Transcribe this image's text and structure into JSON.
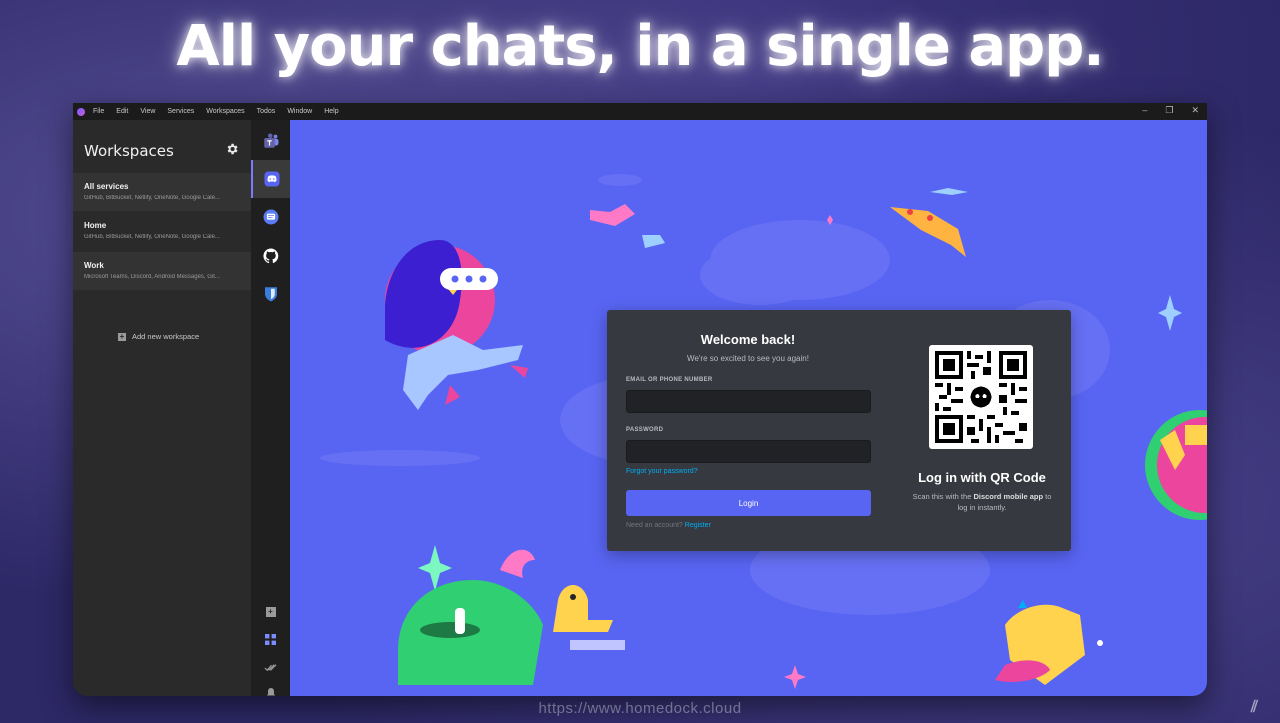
{
  "headline": "All your chats, in a single app.",
  "footer_url": "https://www.homedock.cloud",
  "menubar": {
    "items": [
      "File",
      "Edit",
      "View",
      "Services",
      "Workspaces",
      "Todos",
      "Window",
      "Help"
    ]
  },
  "sidebar": {
    "title": "Workspaces",
    "workspaces": [
      {
        "name": "All services",
        "services": "GitHub, BitBucket, Netlify, OneNote, Google Cale..."
      },
      {
        "name": "Home",
        "services": "GitHub, BitBucket, Netlify, OneNote, Google Cale..."
      },
      {
        "name": "Work",
        "services": "Microsoft Teams, Discord, Android Messages, Git..."
      }
    ],
    "add_label": "Add new workspace"
  },
  "services": [
    {
      "icon": "microsoft-teams-icon",
      "color": "#6264a7"
    },
    {
      "icon": "discord-icon",
      "color": "#5865f2",
      "active": true
    },
    {
      "icon": "android-messages-icon",
      "color": "#5b7cf5"
    },
    {
      "icon": "github-icon",
      "color": "#ffffff"
    },
    {
      "icon": "bitwarden-icon",
      "color": "#3b7ddd"
    }
  ],
  "login": {
    "title": "Welcome back!",
    "subtitle": "We're so excited to see you again!",
    "email_label": "EMAIL OR PHONE NUMBER",
    "email_value": "",
    "password_label": "PASSWORD",
    "password_value": "",
    "forgot": "Forgot your password?",
    "button": "Login",
    "need_account": "Need an account?",
    "register": "Register"
  },
  "qr": {
    "title": "Log in with QR Code",
    "desc_1": "Scan this with the ",
    "desc_bold": "Discord mobile app",
    "desc_2": " to log in instantly."
  },
  "colors": {
    "discord_blurple": "#5865f2",
    "card": "#36393f",
    "link": "#00aff4"
  }
}
